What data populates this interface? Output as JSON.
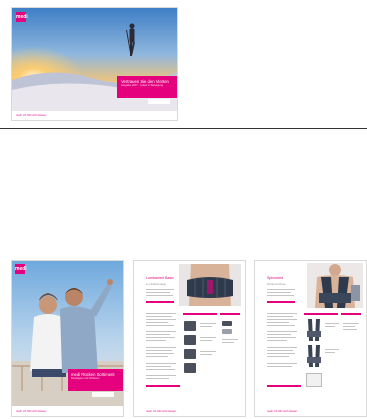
{
  "brand": {
    "logo_text": "medi",
    "accent": "#e5007e"
  },
  "top_card": {
    "band_title": "Vertrauen Sie den Vierten",
    "band_subtitle": "Ausgabe 2017 · Leben in Bewegung",
    "footer": "medi. ich fühl mich besser."
  },
  "brochures": [
    {
      "band_title": "medi Rücken Sortiment",
      "band_subtitle": "Bandagen und Orthesen",
      "footer": "medi. ich fühl mich besser."
    },
    {
      "product_title": "Lumbamed Basic",
      "product_subtitle": "Lumbalbandage",
      "footer": "medi. ich fühl mich besser."
    },
    {
      "product_title": "Spinomed",
      "product_subtitle": "Rückenorthese",
      "footer": "medi. ich fühl mich besser."
    }
  ],
  "icons": {
    "logo": "medi-logo-icon",
    "hiker": "hiker-photo",
    "couple": "couple-photo",
    "lumbar": "back-support-photo",
    "spine": "spine-orthosis-photo"
  }
}
